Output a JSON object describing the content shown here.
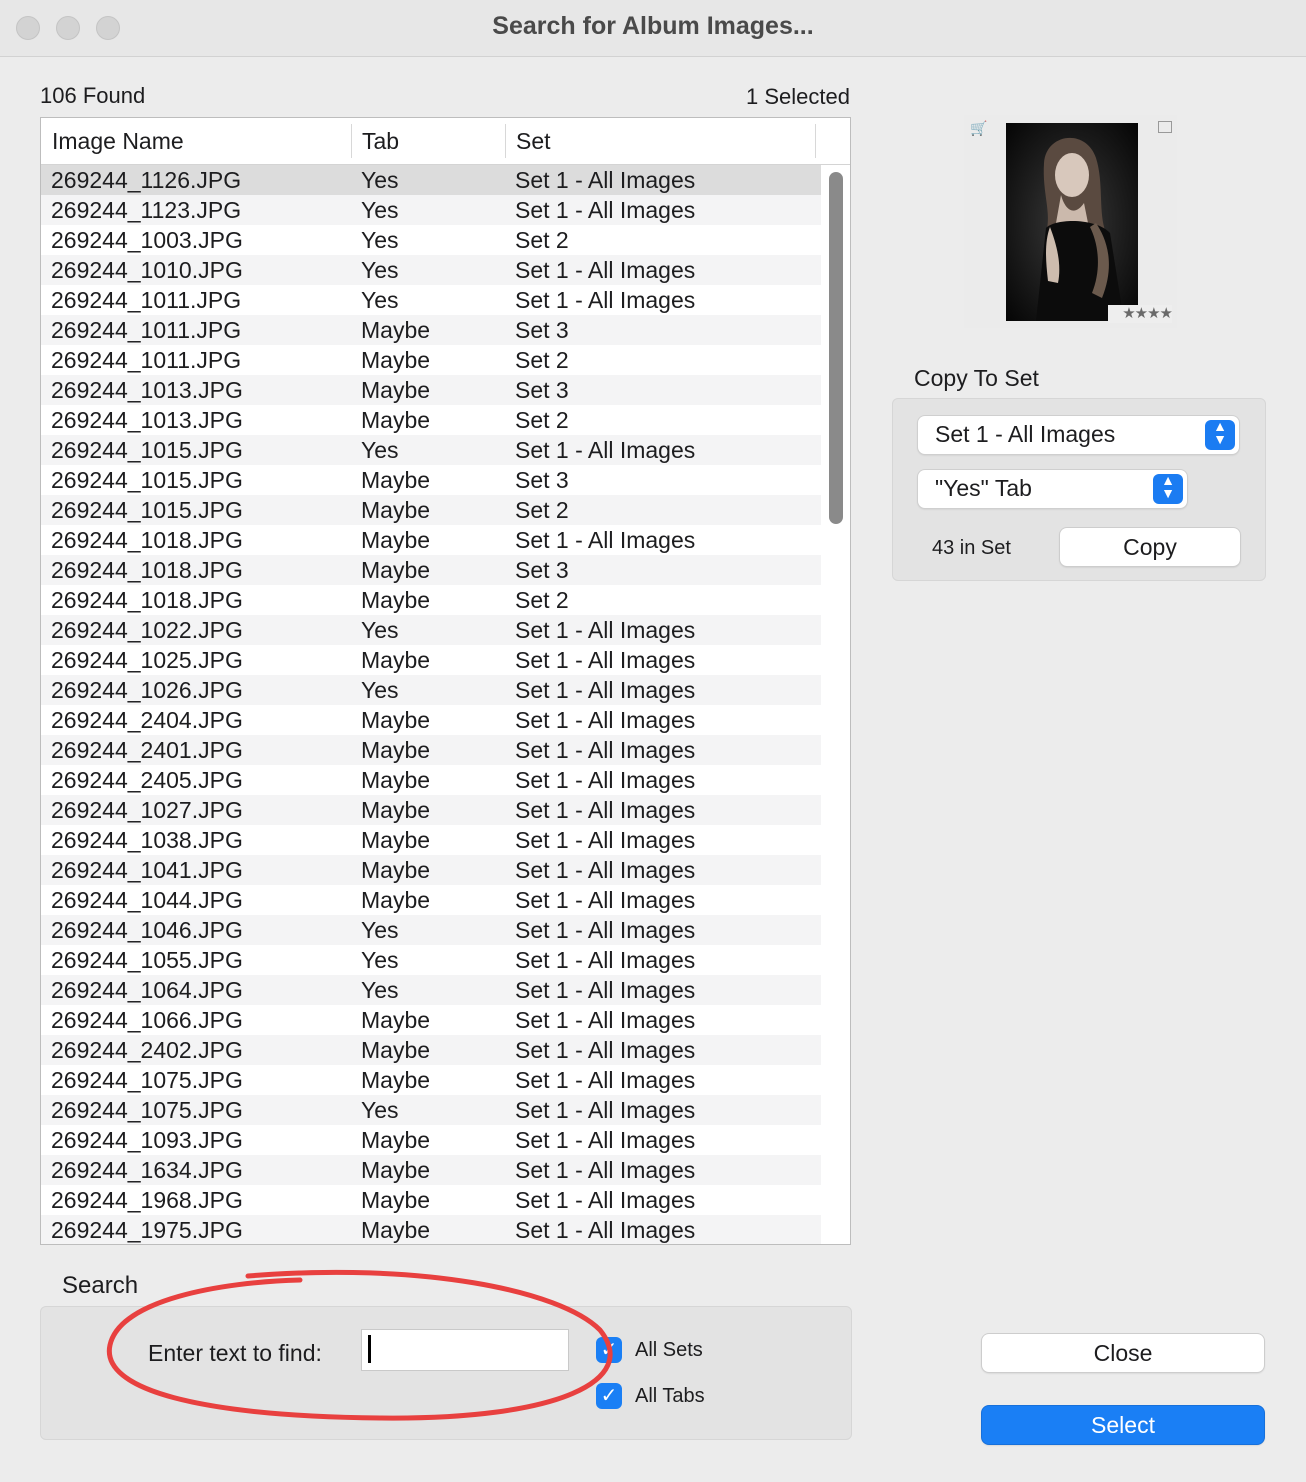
{
  "window": {
    "title": "Search for Album Images..."
  },
  "results": {
    "found_label": "106 Found",
    "selected_label": "1 Selected",
    "columns": [
      "Image Name",
      "Tab",
      "Set"
    ],
    "rows": [
      [
        "269244_1126.JPG",
        "Yes",
        "Set 1 - All Images"
      ],
      [
        "269244_1123.JPG",
        "Yes",
        "Set 1 - All Images"
      ],
      [
        "269244_1003.JPG",
        "Yes",
        "Set 2"
      ],
      [
        "269244_1010.JPG",
        "Yes",
        "Set 1 - All Images"
      ],
      [
        "269244_1011.JPG",
        "Yes",
        "Set 1 - All Images"
      ],
      [
        "269244_1011.JPG",
        "Maybe",
        "Set 3"
      ],
      [
        "269244_1011.JPG",
        "Maybe",
        "Set 2"
      ],
      [
        "269244_1013.JPG",
        "Maybe",
        "Set 3"
      ],
      [
        "269244_1013.JPG",
        "Maybe",
        "Set 2"
      ],
      [
        "269244_1015.JPG",
        "Yes",
        "Set 1 - All Images"
      ],
      [
        "269244_1015.JPG",
        "Maybe",
        "Set 3"
      ],
      [
        "269244_1015.JPG",
        "Maybe",
        "Set 2"
      ],
      [
        "269244_1018.JPG",
        "Maybe",
        "Set 1 - All Images"
      ],
      [
        "269244_1018.JPG",
        "Maybe",
        "Set 3"
      ],
      [
        "269244_1018.JPG",
        "Maybe",
        "Set 2"
      ],
      [
        "269244_1022.JPG",
        "Yes",
        "Set 1 - All Images"
      ],
      [
        "269244_1025.JPG",
        "Maybe",
        "Set 1 - All Images"
      ],
      [
        "269244_1026.JPG",
        "Yes",
        "Set 1 - All Images"
      ],
      [
        "269244_2404.JPG",
        "Maybe",
        "Set 1 - All Images"
      ],
      [
        "269244_2401.JPG",
        "Maybe",
        "Set 1 - All Images"
      ],
      [
        "269244_2405.JPG",
        "Maybe",
        "Set 1 - All Images"
      ],
      [
        "269244_1027.JPG",
        "Maybe",
        "Set 1 - All Images"
      ],
      [
        "269244_1038.JPG",
        "Maybe",
        "Set 1 - All Images"
      ],
      [
        "269244_1041.JPG",
        "Maybe",
        "Set 1 - All Images"
      ],
      [
        "269244_1044.JPG",
        "Maybe",
        "Set 1 - All Images"
      ],
      [
        "269244_1046.JPG",
        "Yes",
        "Set 1 - All Images"
      ],
      [
        "269244_1055.JPG",
        "Yes",
        "Set 1 - All Images"
      ],
      [
        "269244_1064.JPG",
        "Yes",
        "Set 1 - All Images"
      ],
      [
        "269244_1066.JPG",
        "Maybe",
        "Set 1 - All Images"
      ],
      [
        "269244_2402.JPG",
        "Maybe",
        "Set 1 - All Images"
      ],
      [
        "269244_1075.JPG",
        "Maybe",
        "Set 1 - All Images"
      ],
      [
        "269244_1075.JPG",
        "Yes",
        "Set 1 - All Images"
      ],
      [
        "269244_1093.JPG",
        "Maybe",
        "Set 1 - All Images"
      ],
      [
        "269244_1634.JPG",
        "Maybe",
        "Set 1 - All Images"
      ],
      [
        "269244_1968.JPG",
        "Maybe",
        "Set 1 - All Images"
      ],
      [
        "269244_1975.JPG",
        "Maybe",
        "Set 1 - All Images"
      ]
    ],
    "selected_row": 0
  },
  "preview": {
    "rating_stars": "★★★★"
  },
  "copy_to_set": {
    "title": "Copy To Set",
    "set_selected": "Set 1 - All Images",
    "tab_selected": "\"Yes\" Tab",
    "count_label": "43 in Set",
    "copy_label": "Copy"
  },
  "search": {
    "title": "Search",
    "find_label": "Enter text to find:",
    "find_value": "",
    "all_sets_label": "All Sets",
    "all_sets_checked": true,
    "all_tabs_label": "All Tabs",
    "all_tabs_checked": true
  },
  "buttons": {
    "close_label": "Close",
    "select_label": "Select"
  },
  "colors": {
    "accent": "#1a7ff5",
    "annotation": "#e8403f"
  }
}
